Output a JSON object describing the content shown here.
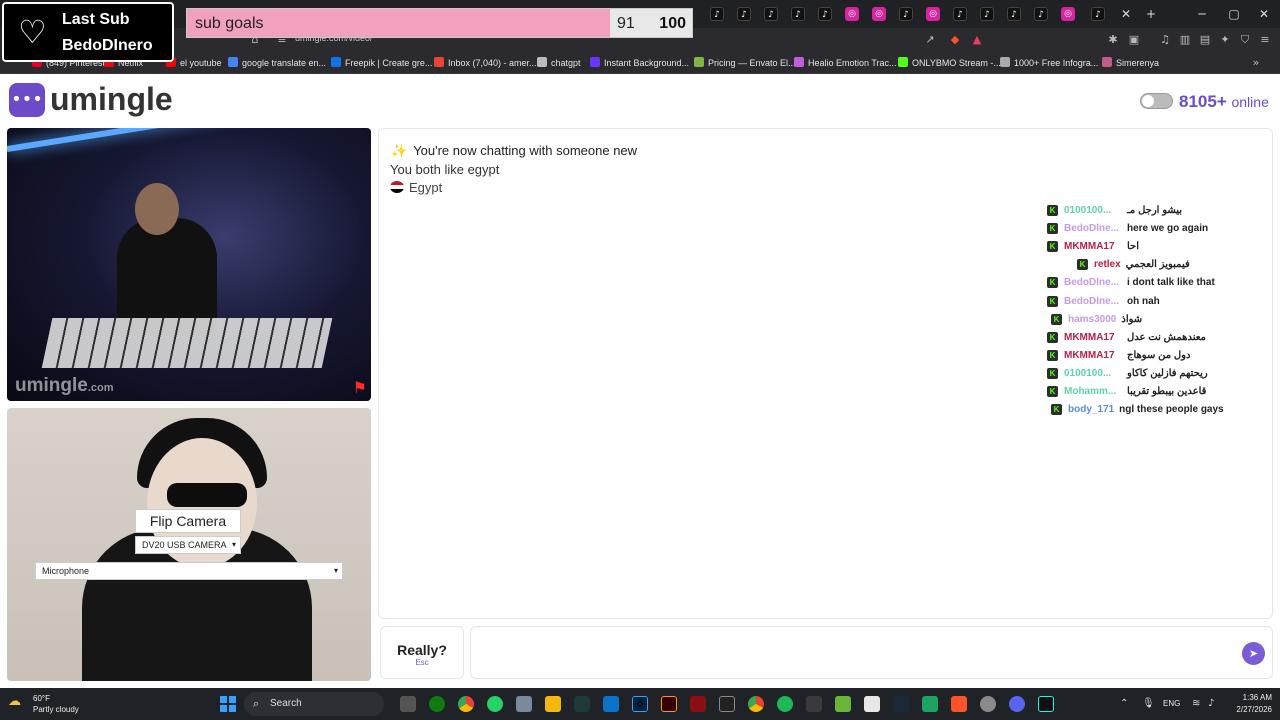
{
  "browser": {
    "url": "umingle.com/video/",
    "bookmarks": [
      {
        "label": "(849) Pinterest",
        "color": "#e60023"
      },
      {
        "label": "Netflix",
        "color": "#e50914"
      },
      {
        "label": "el youtube",
        "color": "#ff0000"
      },
      {
        "label": "google translate en...",
        "color": "#4285f4"
      },
      {
        "label": "Freepik | Create gre...",
        "color": "#1273eb"
      },
      {
        "label": "Inbox (7,040) - amer...",
        "color": "#ea4335"
      },
      {
        "label": "chatgpt",
        "color": "#bbbbbb"
      },
      {
        "label": "Instant Background...",
        "color": "#6a35ff"
      },
      {
        "label": "Pricing — Envato El...",
        "color": "#82b541"
      },
      {
        "label": "Healio Emotion Trac...",
        "color": "#c25de0"
      },
      {
        "label": "ONLYBMO Stream -...",
        "color": "#53fc18"
      },
      {
        "label": "1000+ Free Infogra...",
        "color": "#aaaaaa"
      },
      {
        "label": "Simerenya",
        "color": "#c35b8a"
      }
    ]
  },
  "overlay": {
    "last_sub_title": "Last Sub",
    "last_sub_name": "BedoDInero",
    "sub_goals_label": "sub goals",
    "sub_goals_current": "91",
    "sub_goals_target": "100",
    "sub_goals_progress": 0.91
  },
  "site": {
    "logo_text": "umingle",
    "online_count": "8105+",
    "online_word": "online",
    "watermark": "umingle",
    "watermark_suffix": ".com",
    "flip_camera": "Flip Camera",
    "camera_select": "DV20 USB CAMERA",
    "mic_select": "Microphone",
    "system_line1": "You're now chatting with someone new",
    "system_line2": "You both like egypt",
    "system_line3": "Egypt",
    "really_label": "Really?",
    "really_hint": "Esc",
    "accent": "#6b4bc7"
  },
  "kick_chat": [
    {
      "user": "0100100...",
      "text": "بيشو ارجل مـ",
      "color": "#5fd0b0"
    },
    {
      "user": "BedoDlne...",
      "text": "here we go again",
      "color": "#c59be6"
    },
    {
      "user": "MKMMA17",
      "text": "احا",
      "color": "#b8204a"
    },
    {
      "user": "retlex",
      "text": "فيمبويز العجمي",
      "color": "#b8204a"
    },
    {
      "user": "BedoDlne...",
      "text": "i dont talk like that",
      "color": "#c59be6"
    },
    {
      "user": "BedoDlne...",
      "text": "oh nah",
      "color": "#c59be6"
    },
    {
      "user": "hams3000",
      "text": "شواذ",
      "color": "#c59be6"
    },
    {
      "user": "MKMMA17",
      "text": "معندهمش نت عدل",
      "color": "#b8204a"
    },
    {
      "user": "MKMMA17",
      "text": "دول من سوهاج",
      "color": "#b8204a"
    },
    {
      "user": "0100100...",
      "text": "ريحتهم فازلين كاكاو",
      "color": "#5fd0b0"
    },
    {
      "user": "Mohamm...",
      "text": "قاعدين بيبطو تقريبا",
      "color": "#5fd0b0"
    },
    {
      "user": "body_171",
      "text": "ngl these people gays",
      "color": "#5a8fd6"
    }
  ],
  "taskbar": {
    "temp": "60°F",
    "weather": "Partly cloudy",
    "search": "Search",
    "lang": "ENG",
    "time": "1:36 AM",
    "date": "2/27/2026"
  }
}
